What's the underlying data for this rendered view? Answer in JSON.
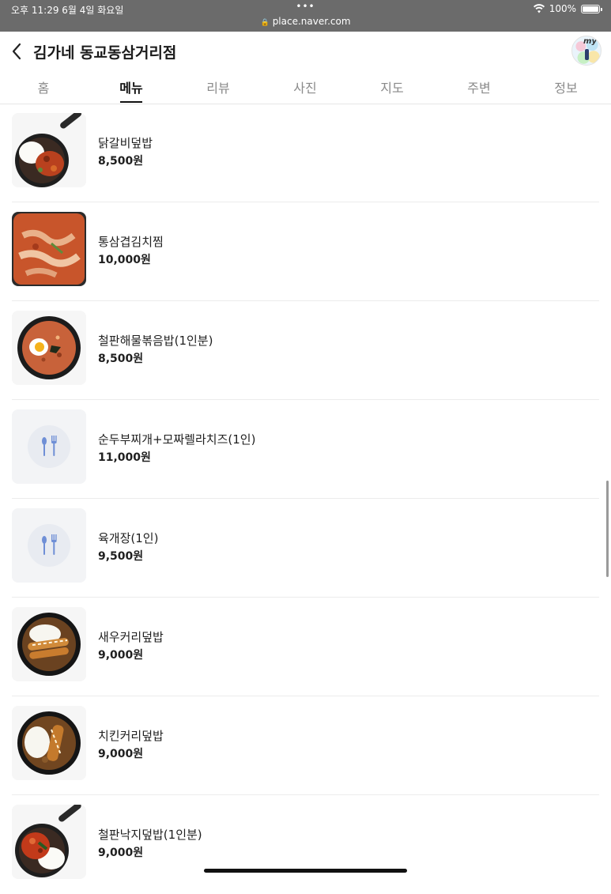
{
  "status_bar": {
    "time": "오후 11:29   6월 4일 화요일",
    "dots": "•••",
    "url": "place.naver.com",
    "battery": "100%",
    "battery_level": 1.0
  },
  "header": {
    "title": "김가네 동교동삼거리점",
    "avatar_text": "my"
  },
  "tabs": [
    {
      "label": "홈",
      "active": false
    },
    {
      "label": "메뉴",
      "active": true
    },
    {
      "label": "리뷰",
      "active": false
    },
    {
      "label": "사진",
      "active": false
    },
    {
      "label": "지도",
      "active": false
    },
    {
      "label": "주변",
      "active": false
    },
    {
      "label": "정보",
      "active": false
    }
  ],
  "menu": [
    {
      "name": "닭갈비덮밥",
      "price": "8,500원",
      "thumb": "skillet-rice-icon"
    },
    {
      "name": "통삼겹김치찜",
      "price": "10,000원",
      "thumb": "stew-icon"
    },
    {
      "name": "철판해물볶음밥(1인분)",
      "price": "8,500원",
      "thumb": "fried-rice-egg-icon"
    },
    {
      "name": "순두부찌개+모짜렐라치즈(1인)",
      "price": "11,000원",
      "thumb": "utensils-placeholder-icon"
    },
    {
      "name": "육개장(1인)",
      "price": "9,500원",
      "thumb": "utensils-placeholder-icon"
    },
    {
      "name": "새우커리덮밥",
      "price": "9,000원",
      "thumb": "shrimp-curry-icon"
    },
    {
      "name": "치킨커리덮밥",
      "price": "9,000원",
      "thumb": "chicken-curry-icon"
    },
    {
      "name": "철판낙지덮밥(1인분)",
      "price": "9,000원",
      "thumb": "skillet-octopus-icon"
    }
  ],
  "colors": {
    "status_bar_bg": "#6b6b6b",
    "tab_active": "#111111",
    "tab_inactive": "#8a8a8a",
    "placeholder_icon": "#6f8fd6"
  }
}
